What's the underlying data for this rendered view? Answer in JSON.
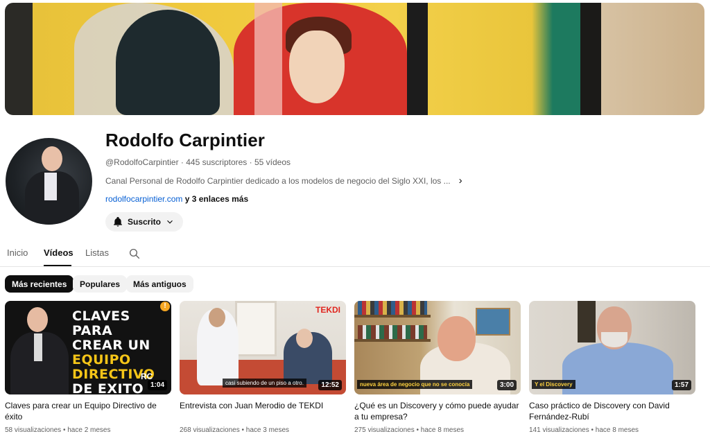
{
  "channel": {
    "name": "Rodolfo Carpintier",
    "handle": "@RodolfoCarpintier",
    "subscribers": "445 suscriptores",
    "videos_count": "55 vídeos",
    "separator": "·",
    "description": "Canal Personal de Rodolfo Carpintier dedicado a los modelos de negocio del Siglo XXI, los ...",
    "link": "rodolfocarpintier.com",
    "more_links": "y 3 enlaces más",
    "subscribe_label": "Suscrito"
  },
  "tabs": [
    {
      "label": "Inicio",
      "active": false
    },
    {
      "label": "Vídeos",
      "active": true
    },
    {
      "label": "Listas",
      "active": false
    }
  ],
  "filters": [
    {
      "label": "Más recientes",
      "active": true
    },
    {
      "label": "Populares",
      "active": false
    },
    {
      "label": "Más antiguos",
      "active": false
    }
  ],
  "videos": [
    {
      "title": "Claves para crear un Equipo Directivo de éxito",
      "views": "58 visualizaciones",
      "age": "hace 2 meses",
      "duration": "1:04",
      "thumb_lines": [
        "CLAVES PARA",
        "CREAR UN",
        "EQUIPO",
        "DIRECTIVO",
        "DE EXITO"
      ],
      "thumb_badge": "!",
      "thumb_logo": "RC"
    },
    {
      "title": "Entrevista con Juan Merodio de TEKDI",
      "views": "268 visualizaciones",
      "age": "hace 3 meses",
      "duration": "12:52",
      "thumb_logo": "TEKDI",
      "thumb_caption": "casi subiendo de un piso a otro."
    },
    {
      "title": "¿Qué es un Discovery y cómo puede ayudar a tu empresa?",
      "views": "275 visualizaciones",
      "age": "hace 8 meses",
      "duration": "3:00",
      "thumb_caption": "nueva área de negocio que no se conocía"
    },
    {
      "title": "Caso práctico de Discovery con David Fernández-Rubí",
      "views": "141 visualizaciones",
      "age": "hace 8 meses",
      "duration": "1:57",
      "thumb_caption": "Y el Discovery"
    }
  ],
  "colors": {
    "link": "#065fd4",
    "progress": "#ff0000",
    "chip_active": "#0f0f0f"
  }
}
